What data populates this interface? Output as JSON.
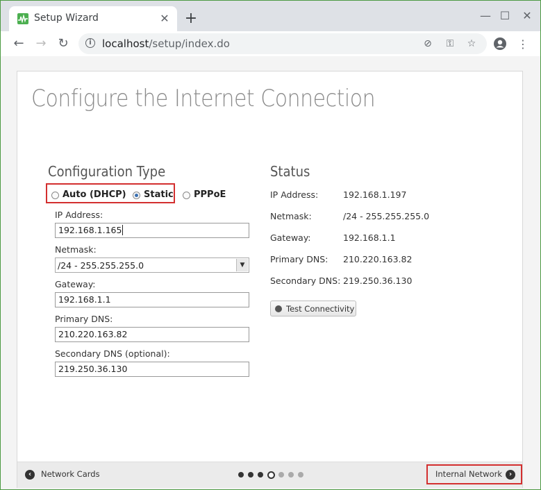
{
  "browser": {
    "tab_title": "Setup Wizard",
    "url_host": "localhost",
    "url_path": "/setup/index.do"
  },
  "page": {
    "title": "Configure the Internet Connection"
  },
  "config": {
    "section_title": "Configuration Type",
    "options": [
      {
        "label": "Auto (DHCP)",
        "checked": false
      },
      {
        "label": "Static",
        "checked": true
      },
      {
        "label": "PPPoE",
        "checked": false
      }
    ],
    "ip_label": "IP Address:",
    "ip_value": "192.168.1.165",
    "netmask_label": "Netmask:",
    "netmask_value": "/24 - 255.255.255.0",
    "gateway_label": "Gateway:",
    "gateway_value": "192.168.1.1",
    "dns1_label": "Primary DNS:",
    "dns1_value": "210.220.163.82",
    "dns2_label": "Secondary DNS (optional):",
    "dns2_value": "219.250.36.130"
  },
  "status": {
    "section_title": "Status",
    "rows": [
      {
        "label": "IP Address:",
        "value": "192.168.1.197"
      },
      {
        "label": "Netmask:",
        "value": "/24 - 255.255.255.0"
      },
      {
        "label": "Gateway:",
        "value": "192.168.1.1"
      },
      {
        "label": "Primary DNS:",
        "value": "210.220.163.82"
      },
      {
        "label": "Secondary DNS:",
        "value": "219.250.36.130"
      }
    ],
    "test_button": "Test Connectivity"
  },
  "footer": {
    "prev_label": "Network Cards",
    "next_label": "Internal Network",
    "steps_total": 7,
    "current_step": 4
  },
  "colors": {
    "highlight": "#d32f2f",
    "favicon": "#4caf50"
  }
}
